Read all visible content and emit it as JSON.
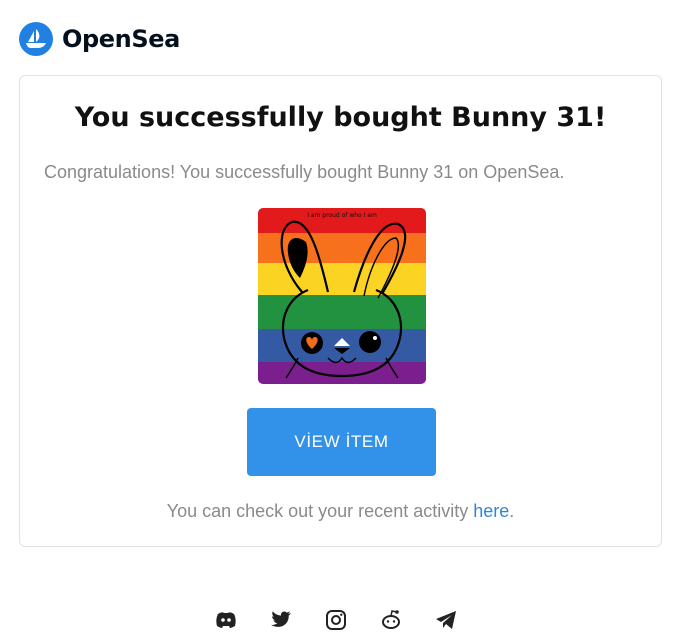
{
  "brand": {
    "name": "OpenSea",
    "color": "#2081e2",
    "icon": "opensea-logo-icon"
  },
  "email": {
    "title": "You successfully bought Bunny 31!",
    "message": "Congratulations! You successfully bought Bunny 31 on OpenSea.",
    "image_caption": "I am proud of who I am",
    "button_label": "VİEW İTEM",
    "activity_prefix": "You can check out your recent activity ",
    "activity_link": "here",
    "activity_suffix": "."
  },
  "colors": {
    "button": "#3291e9",
    "link": "#2f86d6",
    "muted_text": "#8a8a8a"
  },
  "socials": [
    {
      "name": "discord-icon"
    },
    {
      "name": "twitter-icon"
    },
    {
      "name": "instagram-icon"
    },
    {
      "name": "reddit-icon"
    },
    {
      "name": "telegram-icon"
    }
  ]
}
